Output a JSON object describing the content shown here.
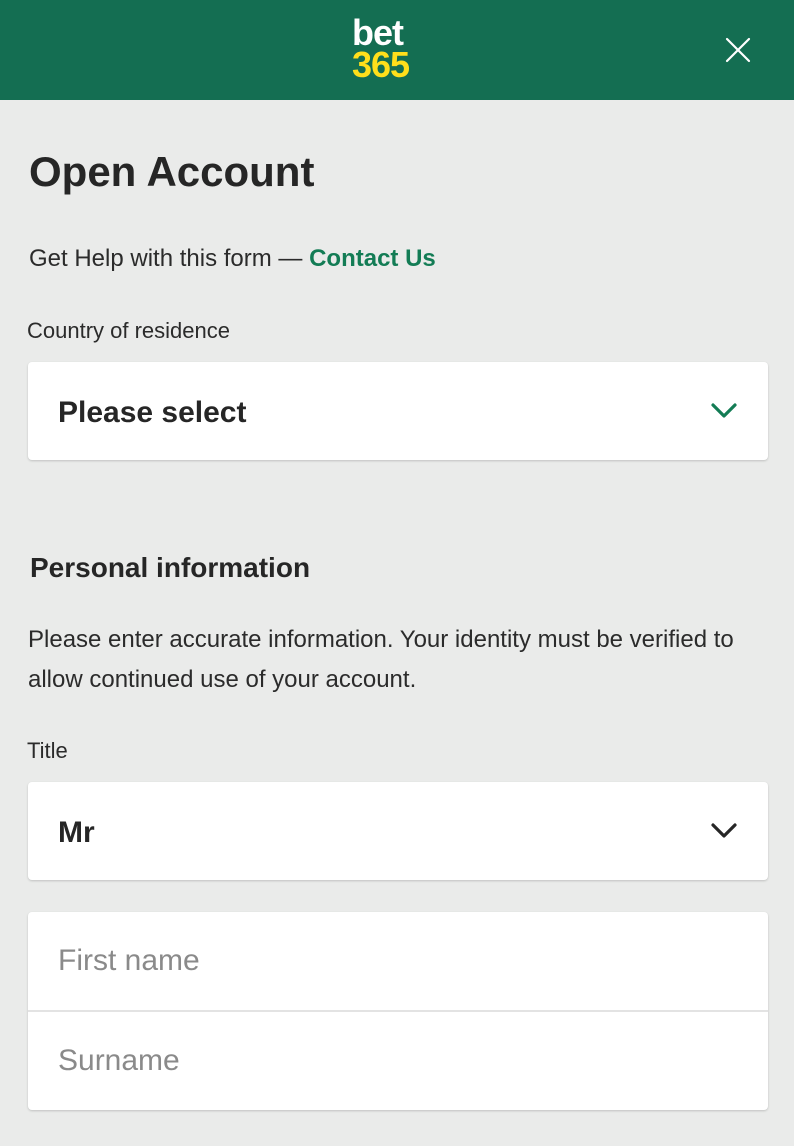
{
  "brand": {
    "logo_top": "bet",
    "logo_bottom": "365",
    "header_color": "#146e52",
    "logo_accent": "#ffdf1b"
  },
  "header": {
    "close_icon": "close-icon"
  },
  "form": {
    "title": "Open Account",
    "help_text": "Get Help with this form — ",
    "help_link": "Contact Us",
    "country": {
      "label": "Country of residence",
      "value": "Please select",
      "icon": "chevron-down-icon",
      "icon_color": "#137c55"
    },
    "personal": {
      "heading": "Personal information",
      "description": "Please enter accurate information. Your identity must be verified to allow continued use of your account."
    },
    "title_field": {
      "label": "Title",
      "value": "Mr",
      "icon": "chevron-down-icon"
    },
    "first_name": {
      "placeholder": "First name",
      "value": ""
    },
    "surname": {
      "placeholder": "Surname",
      "value": ""
    }
  }
}
